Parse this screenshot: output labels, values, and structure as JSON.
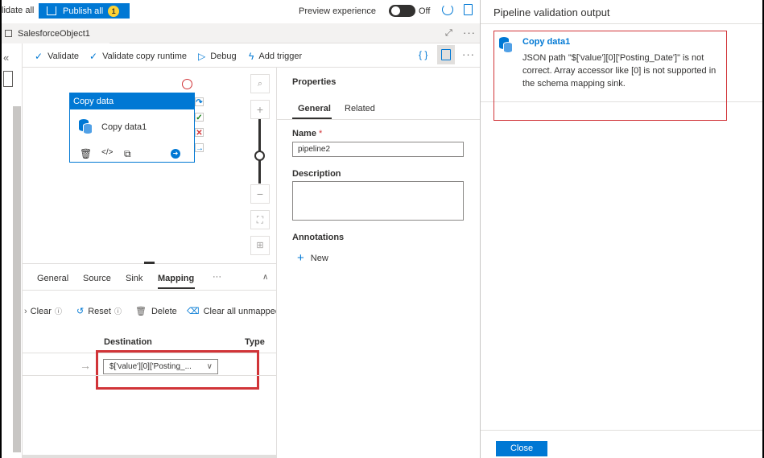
{
  "topbar": {
    "validate_all": "lidate all",
    "publish_label": "Publish all",
    "publish_count": "1",
    "preview_label": "Preview experience",
    "toggle_state": "Off"
  },
  "tabs": {
    "document_tab": "SalesforceObject1"
  },
  "toolbar": {
    "validate": "Validate",
    "validate_copy_runtime": "Validate copy runtime",
    "debug": "Debug",
    "add_trigger": "Add trigger",
    "code_icon": "{ }"
  },
  "canvas": {
    "activity_type": "Copy data",
    "activity_name": "Copy data1"
  },
  "bottom_panel": {
    "tabs": [
      "General",
      "Source",
      "Sink",
      "Mapping"
    ],
    "active_tab": "Mapping",
    "more": "···",
    "clear": "Clear",
    "reset": "Reset",
    "delete": "Delete",
    "clear_unmapped": "Clear all unmapped",
    "col_destination": "Destination",
    "col_type": "Type",
    "destination_value": "$['value'][0]['Posting_..."
  },
  "properties": {
    "title": "Properties",
    "tab_general": "General",
    "tab_related": "Related",
    "name_label": "Name",
    "name_required": "*",
    "name_value": "pipeline2",
    "description_label": "Description",
    "description_value": "",
    "annotations_label": "Annotations",
    "new_label": "New"
  },
  "validation": {
    "title": "Pipeline validation output",
    "activity_name": "Copy data1",
    "message": "JSON path \"$['value'][0]['Posting_Date']\" is not correct. Array accessor like [0] is not supported in the schema mapping sink.",
    "close_label": "Close"
  },
  "colors": {
    "accent": "#0078d4",
    "error": "#d13438"
  }
}
